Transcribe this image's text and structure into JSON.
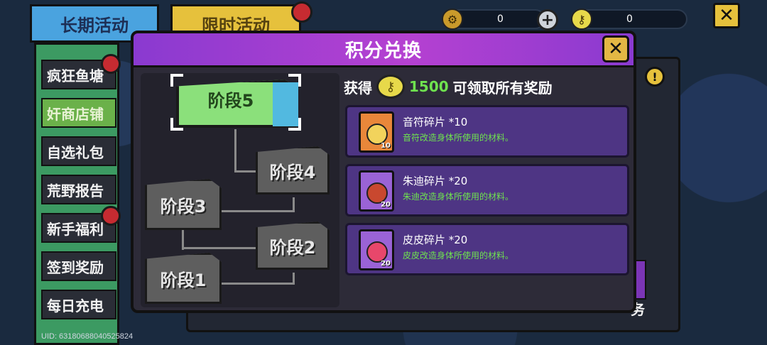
{
  "tabs": [
    {
      "label": "长期活动",
      "active": true
    },
    {
      "label": "限时活动",
      "active": false
    }
  ],
  "currency": [
    {
      "icon": "gear-coin-icon",
      "value": "0"
    },
    {
      "icon": "key-coin-icon",
      "value": "0"
    }
  ],
  "sidebar": {
    "items": [
      {
        "label": "疯狂鱼塘",
        "badge": true
      },
      {
        "label": "奸商店铺",
        "badge": false,
        "active": true
      },
      {
        "label": "自选礼包",
        "badge": false
      },
      {
        "label": "荒野报告",
        "badge": false
      },
      {
        "label": "新手福利",
        "badge": true
      },
      {
        "label": "签到奖励",
        "badge": false
      },
      {
        "label": "每日充电",
        "badge": false
      }
    ]
  },
  "uid": "UID: 6318068804052582​4",
  "background_task_label": "务",
  "modal": {
    "title": "积分兑换",
    "stages": [
      "阶段5",
      "阶段4",
      "阶段3",
      "阶段2",
      "阶段1"
    ],
    "reward_head": {
      "prefix": "获得",
      "amount": "1500",
      "suffix": "可领取所有奖励"
    },
    "rewards": [
      {
        "name": "音符碎片 *10",
        "desc": "音符改造身体所使用的材料。",
        "count": "10",
        "bg": "#e9873a",
        "face": "#f2d35c"
      },
      {
        "name": "朱迪碎片 *20",
        "desc": "朱迪改造身体所使用的材料。",
        "count": "20",
        "bg": "#9a63d6",
        "face": "#c9482f"
      },
      {
        "name": "皮皮碎片 *20",
        "desc": "皮皮改造身体所使用的材料。",
        "count": "20",
        "bg": "#9a63d6",
        "face": "#e8476b"
      }
    ]
  },
  "colors": {
    "accent_purple": "#b541d1",
    "highlight_green": "#6fe24f",
    "gold": "#e3b744"
  }
}
